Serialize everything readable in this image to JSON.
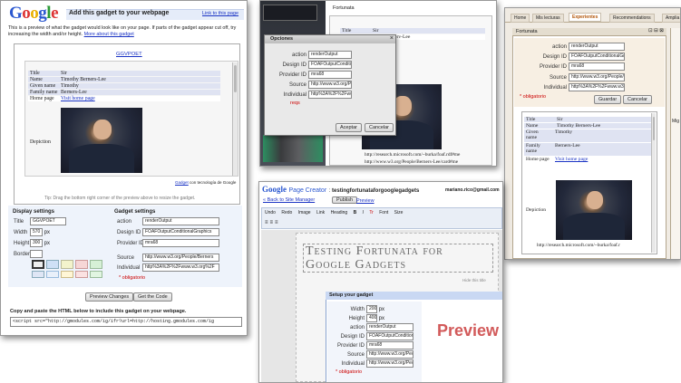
{
  "w1": {
    "title": "Add this gadget to your webpage",
    "link_to_page": "Link to this page",
    "intro": "This is a preview of what the gadget would look like on your page. If parts of the gadget appear cut off, try increasing the width and/or height.",
    "more_about": "More about this gadget",
    "gadget_link": "GGVPOET",
    "rows": [
      {
        "k": "Title",
        "v": "Sir"
      },
      {
        "k": "Name",
        "v": "Timothy Berners-Lee"
      },
      {
        "k": "Given name",
        "v": "Timothy"
      },
      {
        "k": "Family name",
        "v": "Berners-Lee"
      },
      {
        "k": "Home page",
        "v": "Visit home page"
      }
    ],
    "depiction": "Depiction",
    "gadget_credit_a": "Gadget",
    "gadget_credit_b": "con tecnología de Google",
    "tip": "Tip: Drag the bottom right corner of the preview above to resize the gadget.",
    "display_settings": "Display settings",
    "gadget_settings": "Gadget settings",
    "display": [
      {
        "k": "Title",
        "v": "GGVPOET"
      },
      {
        "k": "Width",
        "v": "570",
        "u": "px"
      },
      {
        "k": "Height",
        "v": "300",
        "u": "px"
      },
      {
        "k": "Border",
        "v": ""
      }
    ],
    "settings": [
      {
        "k": "action",
        "v": "renderOutput"
      },
      {
        "k": "Design ID",
        "v": "FOAFOutputConditionalGraphics"
      },
      {
        "k": "Provider ID",
        "v": "mra68"
      },
      {
        "k": "Source",
        "v": "http://www.w3.org/People/Berners"
      },
      {
        "k": "Individual",
        "v": "http%3A%2F%2Fwww.w3.org%2F"
      }
    ],
    "obligatorio": "obligatorio",
    "preview_btn": "Preview Changes",
    "getcode_btn": "Get the Code",
    "copy_text": "Copy and paste the HTML below to include this gadget on your webpage.",
    "code": "<script src=\"http://gmodules.com/ig/ifr?url=http://hosting.gmodules.com/ig"
  },
  "w2": {
    "tab": "Fortunata",
    "dialog_title": "Opciones",
    "fields": [
      {
        "k": "action",
        "v": "renderOutput"
      },
      {
        "k": "Design ID",
        "v": "FOAFOutputConditi"
      },
      {
        "k": "Provider ID",
        "v": "mra68"
      },
      {
        "k": "Source",
        "v": "http://www.w3.org/Peo"
      },
      {
        "k": "Individual",
        "v": "http%3A%2F%2Fwww.w"
      }
    ],
    "req": "reqs",
    "accept": "Aceptar",
    "cancel": "Cancelar",
    "bg_rows": [
      {
        "k": "Title",
        "v": "Sir"
      },
      {
        "k": "",
        "v": "erv-Lee"
      }
    ],
    "url1": "http://research.microsoft.com/~burka/foaf.rdf#me",
    "url2": "http://www.w3.org/People/Berners-Lee/card#me"
  },
  "w3": {
    "tabs": [
      "Home",
      "Mis lecturas",
      "Experientes",
      "Recommendations",
      "Amplia"
    ],
    "active_tab": 2,
    "panel": "Fortunata",
    "panel_ctrl": "⊡ ⊟ ⊠",
    "fields": [
      {
        "k": "action",
        "v": "renderOutput"
      },
      {
        "k": "Design ID",
        "v": "FOAFOutputConditionalGraphics"
      },
      {
        "k": "Provider ID",
        "v": "mra68"
      },
      {
        "k": "Source",
        "v": "http://www.w3.org/People/Berners-L"
      },
      {
        "k": "Individual",
        "v": "http%3A%2F%2Fwww.w3.org%2FP"
      }
    ],
    "obligatorio": "obligatorio",
    "save": "Guardar",
    "cancel": "Cancelar",
    "rows": [
      {
        "k": "Title",
        "v": "Sir"
      },
      {
        "k": "Name",
        "v": "Timothy Berners-Lee"
      },
      {
        "k": "Given name",
        "v": "Timothy"
      },
      {
        "k": "Family name",
        "v": "Berners-Lee"
      },
      {
        "k": "Home page",
        "v": "Visit home page"
      }
    ],
    "depiction": "Depiction",
    "url1": "http://research.microsoft.com/~burka/foaf.r",
    "side_b": "Mig"
  },
  "w4": {
    "brand": "Google",
    "app": "Page Creator",
    "site_title": "testingfortunataforgooglegadgets",
    "user": "mariano.rico@gmail.com",
    "back": "« Back to Site Manager",
    "publish": "Publish",
    "preview_link": "Preview",
    "toolbar": [
      "Undo",
      "Redo",
      "Image",
      "Link",
      "Heading",
      "B",
      "I",
      "Tr",
      "Font",
      "Size"
    ],
    "heading": "Testing Fortunata for Google Gadgets",
    "hidden_label": "Hide this title",
    "setup": "Setup your gadget",
    "dims": [
      {
        "k": "Width",
        "v": "200",
        "u": "px"
      },
      {
        "k": "Height",
        "v": "400",
        "u": "px"
      }
    ],
    "fields": [
      {
        "k": "action",
        "v": "renderOutput"
      },
      {
        "k": "Design ID",
        "v": "FOAFOutputConditional"
      },
      {
        "k": "Provider ID",
        "v": "mra68"
      },
      {
        "k": "Source",
        "v": "http://www.w3.org/Peopl"
      },
      {
        "k": "Individual",
        "v": "http://www.w3.org/Peopl"
      }
    ],
    "obligatorio": "obligatorio",
    "preview_big": "Preview"
  },
  "colors": {
    "google_blue": "#1a33c4",
    "red": "#c00",
    "preview_red": "#d25a5a",
    "rdf_row": "#dfe3f2"
  }
}
